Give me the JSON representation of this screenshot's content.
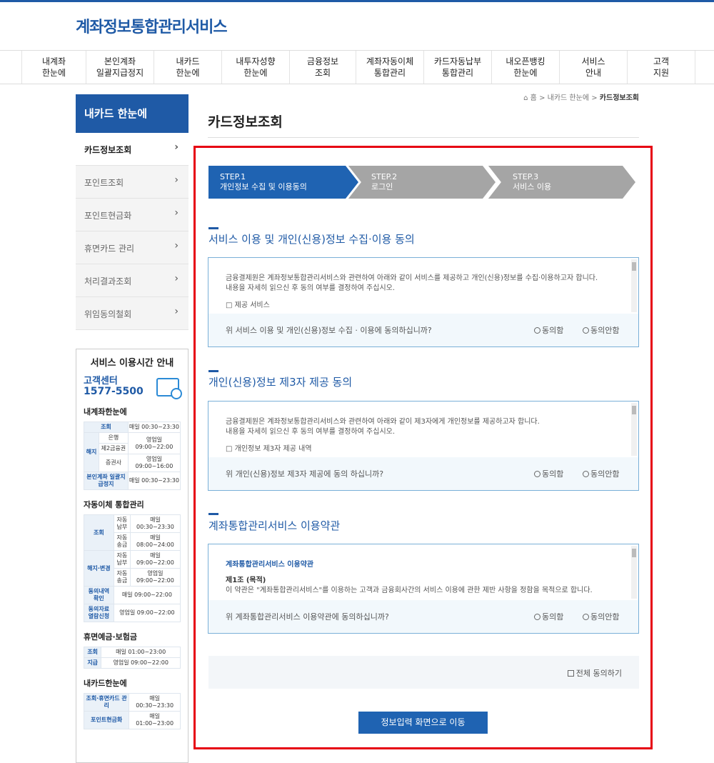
{
  "header": {
    "logo": "계좌정보통합관리서비스"
  },
  "gnb": [
    "내계좌\n한눈에",
    "본인계좌\n일괄지급정지",
    "내카드\n한눈에",
    "내투자성향\n한눈에",
    "금융정보\n조회",
    "계좌자동이체\n통합관리",
    "카드자동납부\n통합관리",
    "내오픈뱅킹\n한눈에",
    "서비스\n안내",
    "고객\n지원"
  ],
  "lnb": {
    "title": "내카드 한눈에",
    "items": [
      "카드정보조회",
      "포인트조회",
      "포인트현금화",
      "휴면카드 관리",
      "처리결과조회",
      "위임동의철회"
    ],
    "chevron": "›"
  },
  "service_hours": {
    "title": "서비스 이용시간 안내",
    "cc_label": "고객센터",
    "cc_number": "1577-5500",
    "sec1": {
      "title": "내계좌한눈에",
      "r1a": "조회",
      "r1b": "매일 00:30~23:30",
      "r2g": "해지",
      "r2a": "은행",
      "r2b": "영업일 09:00~22:00",
      "r3a": "제2금융권",
      "r4a": "증권사",
      "r4b": "영업일 09:00~16:00",
      "r5a": "본인계좌 일괄지급정지",
      "r5b": "매일 00:30~23:30"
    },
    "sec2": {
      "title": "자동이체 통합관리",
      "g1": "조회",
      "a1": "자동납부",
      "b1": "매일 00:30~23:30",
      "a2": "자동송금",
      "b2": "매일 08:00~24:00",
      "g2": "해지·변경",
      "a3": "자동납부",
      "b3": "매일 09:00~22:00",
      "a4": "자동송금",
      "b4": "영업일 09:00~22:00",
      "a5": "동의내역 확인",
      "b5": "매일 09:00~22:00",
      "a6": "동의자료 열람신청",
      "b6": "영업일 09:00~22:00"
    },
    "sec3": {
      "title": "휴면예금·보험금",
      "a1": "조회",
      "b1": "매일 01:00~23:00",
      "a2": "지급",
      "b2": "영업일 09:00~22:00"
    },
    "sec4": {
      "title": "내카드한눈에",
      "a1": "조회·휴면카드 관리",
      "b1": "매일 00:30~23:30",
      "a2": "포인트현금화",
      "b2": "매일 01:00~23:00"
    }
  },
  "breadcrumb": {
    "home_icon": "home-icon",
    "home": "홈",
    "sep": ">",
    "level1": "내카드 한눈에",
    "level2": "카드정보조회"
  },
  "page_title": "카드정보조회",
  "steps": [
    {
      "num": "STEP.1",
      "label": "개인정보 수집 및 이용동의"
    },
    {
      "num": "STEP.2",
      "label": "로그인"
    },
    {
      "num": "STEP.3",
      "label": "서비스 이용"
    }
  ],
  "sections": [
    {
      "title": "서비스 이용 및 개인(신용)정보 수집·이용 동의",
      "line1": "금융결제원은 계좌정보통합관리서비스와 관련하여 아래와 같이 서비스를 제공하고 개인(신용)정보를 수집·이용하고자 합니다.",
      "line2": "내용을 자세히 읽으신 후 동의 여부를 결정하여 주십시오.",
      "line3": "□ 제공 서비스",
      "question": "위 서비스 이용 및 개인(신용)정보 수집 · 이용에 동의하십니까?",
      "agree": "동의함",
      "disagree": "동의안함"
    },
    {
      "title": "개인(신용)정보 제3자 제공 동의",
      "line1": "금융결제원은 계좌정보통합관리서비스와 관련하여 아래와 같이 제3자에게 개인정보를 제공하고자 합니다.",
      "line2": "내용을 자세히 읽으신 후 동의 여부를 결정하여 주십시오.",
      "line3": "□ 개인정보 제3자 제공 내역",
      "question": "위 개인(신용)정보 제3자 제공에 동의 하십니까?",
      "agree": "동의함",
      "disagree": "동의안함"
    },
    {
      "title": "계좌통합관리서비스 이용약관",
      "line1": "계좌통합관리서비스 이용약관",
      "line2": "제1조 (목적)",
      "line3": "이 약관은 \"계좌통합관리서비스\"를 이용하는 고객과 금융회사간의 서비스 이용에 관한 제반 사항을 정함을 목적으로 합니다.",
      "question": "위 계좌통합관리서비스 이용약관에 동의하십니까?",
      "agree": "동의함",
      "disagree": "동의안함"
    }
  ],
  "all_agree": "전체 동의하기",
  "submit": "정보입력 화면으로 이동",
  "colors": {
    "primary": "#1f5aa6",
    "step_active": "#1f63b2",
    "step_inactive": "#a5a5a5",
    "highlight": "#e60012"
  }
}
